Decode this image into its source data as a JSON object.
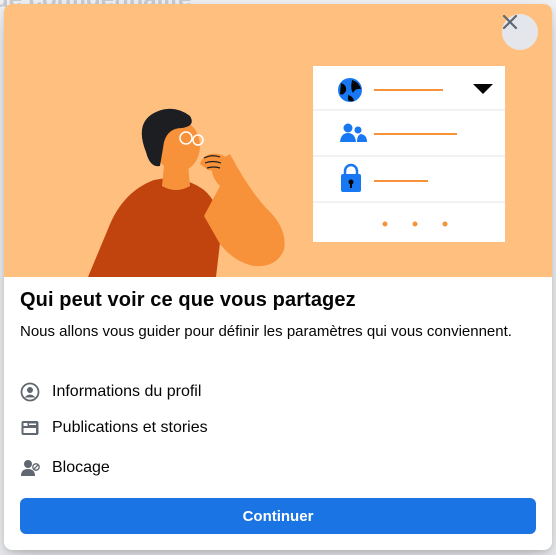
{
  "background": {
    "partial_text": "de confidentialité"
  },
  "dialog": {
    "close_icon": "close-icon",
    "title": "Qui peut voir ce que vous partagez",
    "subtitle": "Nous allons vous guider pour définir les paramètres qui vous conviennent.",
    "items": [
      {
        "label": "Informations du profil",
        "icon": "profile-icon"
      },
      {
        "label": "Publications et stories",
        "icon": "publications-icon"
      },
      {
        "label": "Blocage",
        "icon": "blocking-icon"
      }
    ],
    "continue_label": "Continuer"
  },
  "colors": {
    "accent": "#1b74e4",
    "hero_bg": "#ffc07f",
    "illustration_orange": "#f7923a",
    "illustration_dark_orange": "#c1440e",
    "illustration_blue": "#1877f2"
  }
}
